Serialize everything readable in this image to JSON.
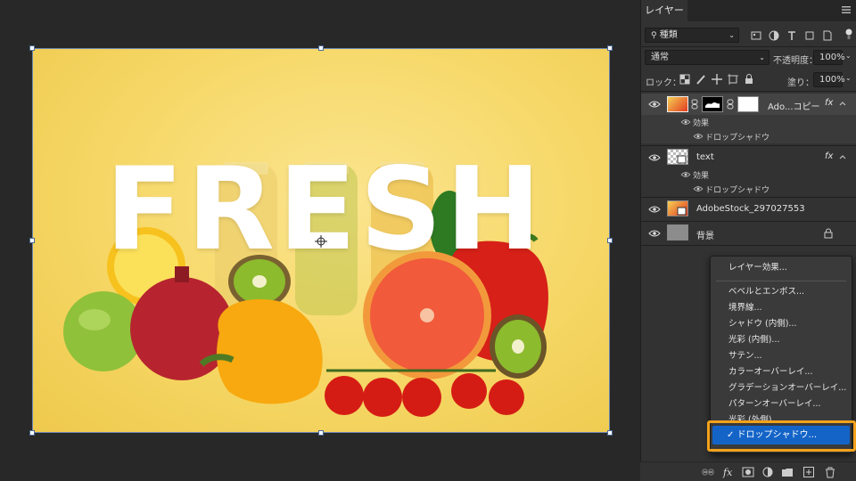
{
  "colors": {
    "accent": "#1464c8",
    "highlight": "#f4a21b",
    "panel_bg": "#323232",
    "canvas_bg": "#282828"
  },
  "canvas": {
    "headline": "FRESH"
  },
  "panel": {
    "tab": "レイヤー",
    "filter": {
      "value": "種類",
      "icon": "search-icon"
    },
    "blend_mode": "通常",
    "opacity_label": "不透明度：",
    "opacity_value": "100%",
    "lock_label": "ロック：",
    "fill_label": "塗り：",
    "fill_value": "100%",
    "layers": [
      {
        "name": "Ado...コピー",
        "fx": "fx",
        "sub_effects": "効果",
        "sub_item": "ドロップシャドウ"
      },
      {
        "name": "text",
        "fx": "fx",
        "sub_effects": "効果",
        "sub_item": "ドロップシャドウ"
      },
      {
        "name": "AdobeStock_297027553"
      },
      {
        "name": "背景"
      }
    ]
  },
  "fx_menu": {
    "items": [
      "レイヤー効果...",
      "ベベルとエンボス...",
      "境界線...",
      "シャドウ (内側)...",
      "光彩 (内側)...",
      "サテン...",
      "カラーオーバーレイ...",
      "グラデーションオーバーレイ...",
      "パターンオーバーレイ...",
      "光彩 (外側)..."
    ],
    "selected": "✓ ドロップシャドウ..."
  }
}
